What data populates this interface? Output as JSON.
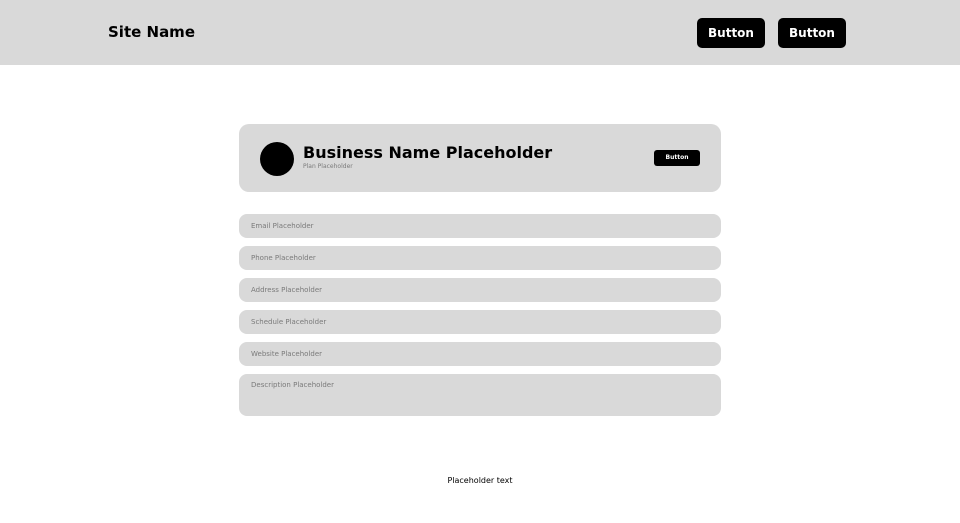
{
  "header": {
    "site_name": "Site Name",
    "buttons": [
      "Button",
      "Button"
    ]
  },
  "profile": {
    "business_name": "Business Name Placeholder",
    "plan": "Plan Placeholder",
    "button_label": "Button"
  },
  "form": {
    "email_placeholder": "Email Placeholder",
    "phone_placeholder": "Phone Placeholder",
    "address_placeholder": "Address Placeholder",
    "schedule_placeholder": "Schedule Placeholder",
    "website_placeholder": "Website Placeholder",
    "description_placeholder": "Description Placeholder"
  },
  "footer": {
    "text": "Placeholder text"
  },
  "colors": {
    "panel": "#d9d9d9",
    "button": "#000000",
    "background": "#ffffff"
  }
}
